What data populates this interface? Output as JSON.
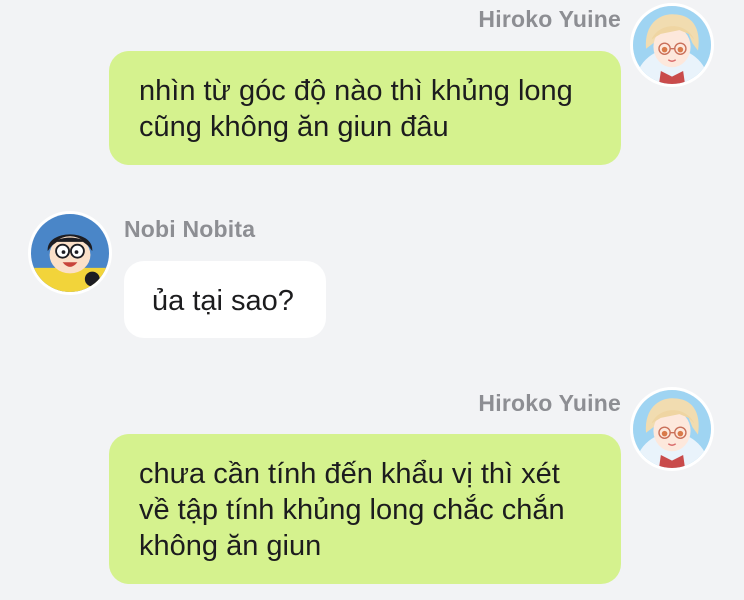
{
  "chat": {
    "messages": [
      {
        "sender": "Hiroko Yuine",
        "direction": "outgoing",
        "avatar_icon": "anime-girl-avatar",
        "lines": [
          "nhìn từ góc độ nào thì khủng long",
          "cũng không ăn giun đâu"
        ]
      },
      {
        "sender": "Nobi Nobita",
        "direction": "incoming",
        "avatar_icon": "nobita-avatar",
        "lines": [
          "ủa tại sao?"
        ]
      },
      {
        "sender": "Hiroko Yuine",
        "direction": "outgoing",
        "avatar_icon": "anime-girl-avatar",
        "lines": [
          "chưa cần tính đến khẩu vị thì xét",
          "về tập tính khủng long chắc chắn",
          "không ăn giun"
        ]
      }
    ]
  },
  "colors": {
    "background": "#f2f3f5",
    "outgoing_bubble": "#d5f28e",
    "incoming_bubble": "#ffffff",
    "sender_name": "#8d8e93",
    "message_text": "#1c1c1e"
  }
}
